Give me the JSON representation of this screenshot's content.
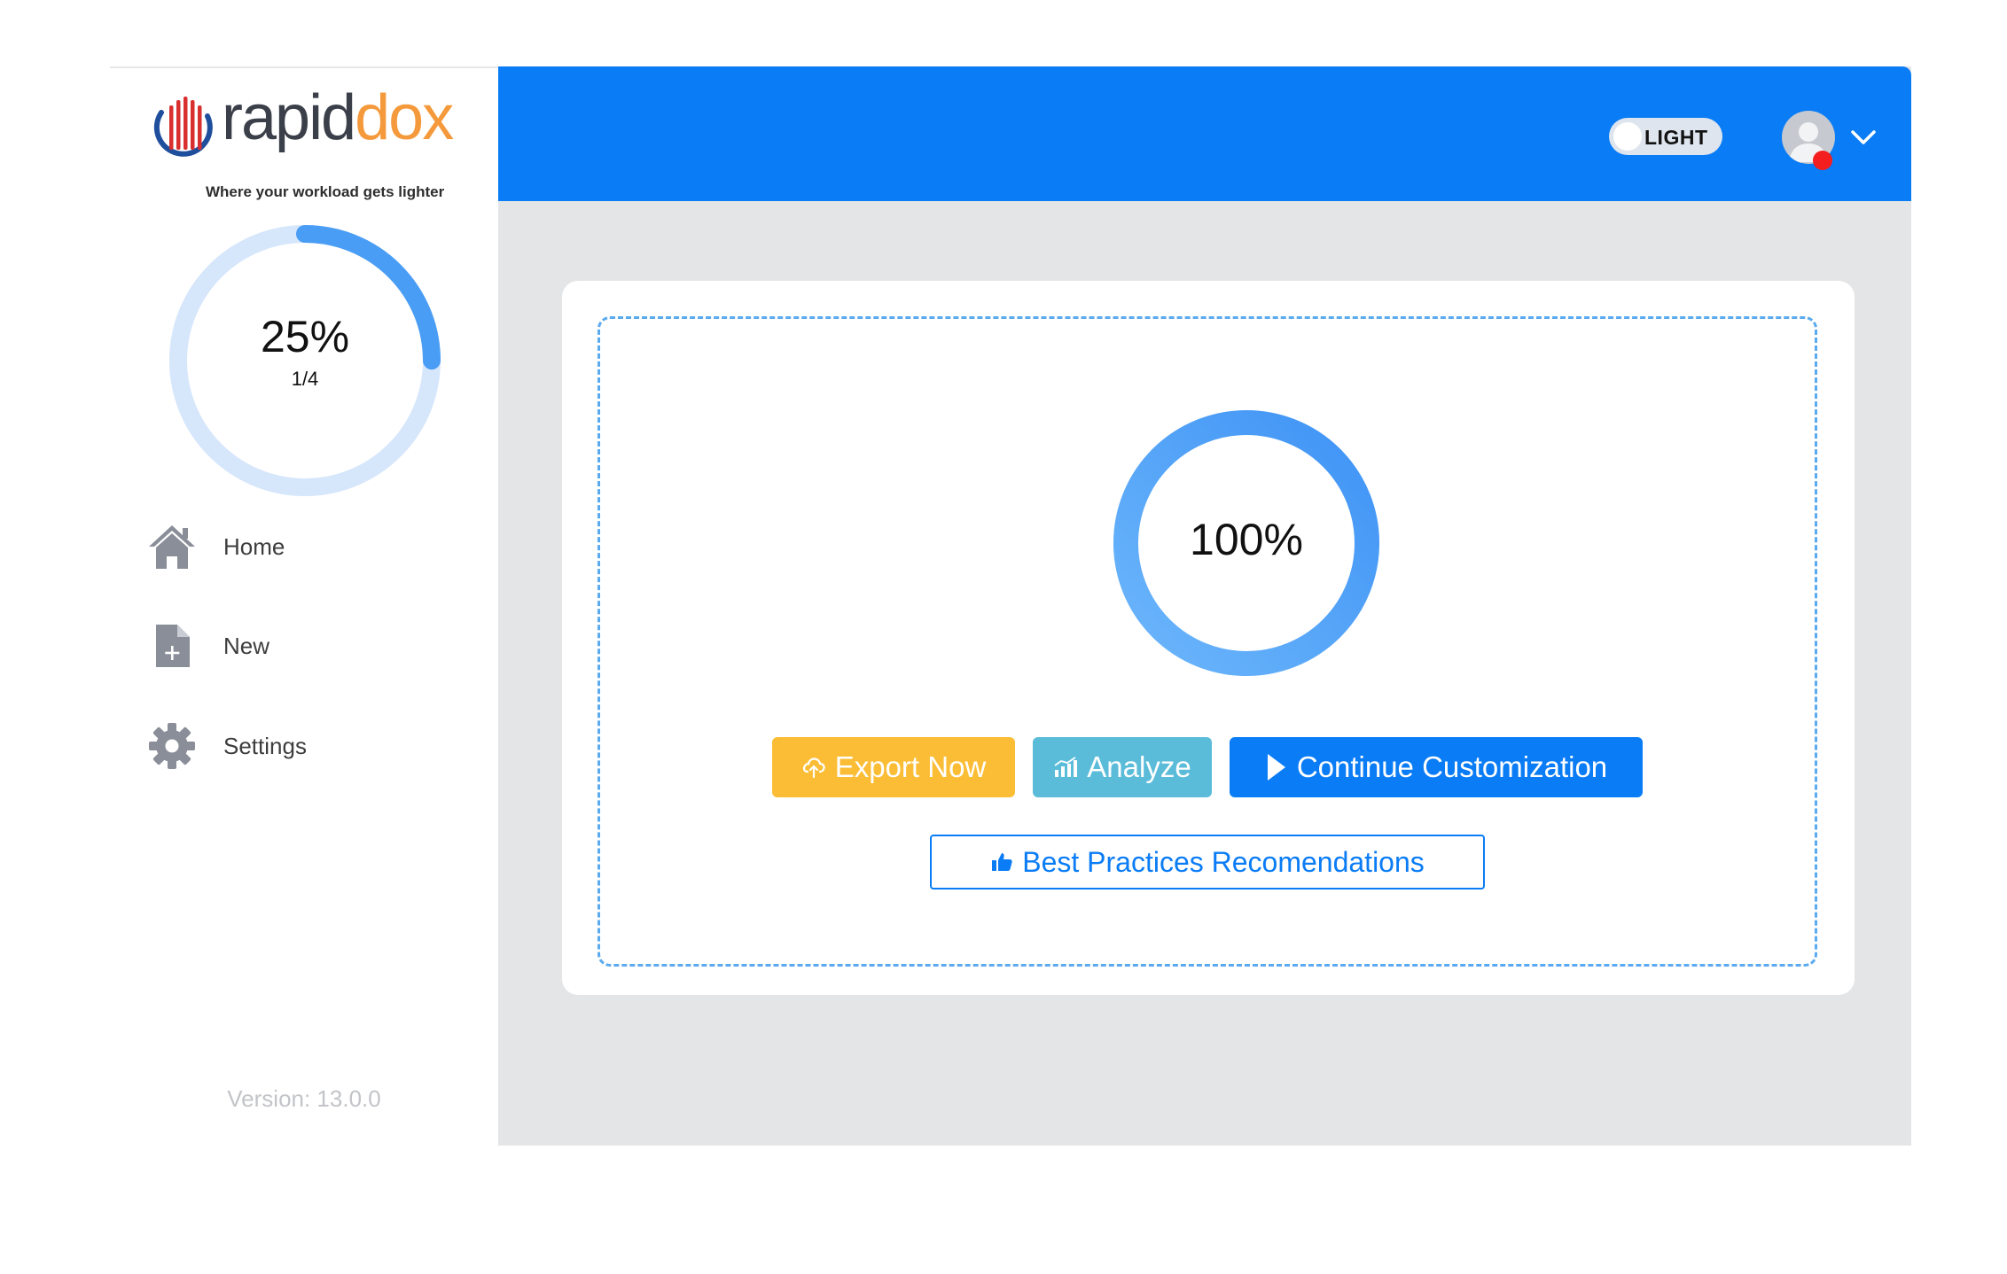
{
  "brand": {
    "name_part1": "rapid",
    "name_part2": "dox",
    "tagline": "Where your workload gets lighter",
    "accent_color": "#f59a3c",
    "stripe_colors": [
      "#1f4e9c",
      "#d8302f"
    ]
  },
  "sidebar": {
    "progress": {
      "percent_label": "25%",
      "fraction_label": "1/4",
      "value": 0.25,
      "track_color": "#d6e6fb",
      "fill_color": "#4a9df5"
    },
    "items": [
      {
        "label": "Home",
        "icon": "home-icon"
      },
      {
        "label": "New",
        "icon": "new-document-icon"
      },
      {
        "label": "Settings",
        "icon": "gear-icon"
      }
    ],
    "version": "Version: 13.0.0"
  },
  "header": {
    "background_color": "#0a7cf5",
    "theme_toggle": {
      "label": "LIGHT"
    },
    "user": {
      "avatar_icon": "user-avatar-icon",
      "status_color": "#f41e1e",
      "menu_icon": "chevron-down-icon"
    }
  },
  "main": {
    "progress": {
      "percent_label": "100%",
      "value": 1.0,
      "color": "#4a9df5"
    },
    "buttons": {
      "export": {
        "label": "Export Now",
        "icon": "cloud-upload-icon",
        "color": "#fbbd35"
      },
      "analyze": {
        "label": "Analyze",
        "icon": "bar-chart-icon",
        "color": "#5bbcd9"
      },
      "continue": {
        "label": "Continue Customization",
        "icon": "play-icon",
        "color": "#0a7cf5"
      },
      "best_practices": {
        "label": "Best Practices Recomendations",
        "icon": "thumbs-up-icon"
      }
    }
  }
}
